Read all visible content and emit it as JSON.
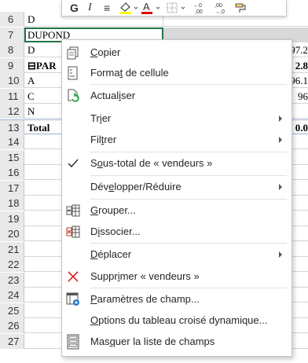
{
  "sheet": {
    "rows": [
      {
        "num": "6",
        "a": "D",
        "b": "",
        "bold": false
      },
      {
        "num": "7",
        "a": "DUPOND",
        "b": "",
        "bold": false,
        "selected": true
      },
      {
        "num": "8",
        "a": "D",
        "b": "97.2",
        "bold": false
      },
      {
        "num": "9",
        "a": "⊟PAR",
        "b": "2.8",
        "bold": true
      },
      {
        "num": "10",
        "a": "A",
        "b": "96.1",
        "bold": false
      },
      {
        "num": "11",
        "a": "C",
        "b": "96",
        "bold": false
      },
      {
        "num": "12",
        "a": "N",
        "b": "",
        "bold": false
      },
      {
        "num": "13",
        "a": "Total",
        "b": "0.0",
        "bold": true,
        "total": true
      },
      {
        "num": "14",
        "a": "",
        "b": ""
      },
      {
        "num": "15",
        "a": "",
        "b": ""
      },
      {
        "num": "16",
        "a": "",
        "b": ""
      },
      {
        "num": "17",
        "a": "",
        "b": ""
      },
      {
        "num": "18",
        "a": "",
        "b": ""
      },
      {
        "num": "19",
        "a": "",
        "b": ""
      },
      {
        "num": "20",
        "a": "",
        "b": ""
      },
      {
        "num": "21",
        "a": "",
        "b": ""
      },
      {
        "num": "22",
        "a": "",
        "b": ""
      },
      {
        "num": "23",
        "a": "",
        "b": ""
      },
      {
        "num": "24",
        "a": "",
        "b": ""
      },
      {
        "num": "25",
        "a": "",
        "b": ""
      },
      {
        "num": "26",
        "a": "",
        "b": ""
      },
      {
        "num": "27",
        "a": "",
        "b": ""
      }
    ]
  },
  "minibar": {
    "bold": "G",
    "italic": "I",
    "align": "≡",
    "fill": "◇",
    "font_color": "A",
    "borders": "⊞",
    "dec_inc": ",00",
    "dec_dec": ",0",
    "paint": "✒"
  },
  "menu": {
    "items": [
      {
        "label": "Copier",
        "icon": "copy-icon",
        "submenu": false
      },
      {
        "label": "Format de cellule",
        "icon": "format-cell-icon",
        "submenu": false
      },
      {
        "label": "Actualiser",
        "icon": "refresh-icon",
        "submenu": false
      },
      {
        "label": "Trier",
        "icon": "",
        "submenu": true
      },
      {
        "label": "Filtrer",
        "icon": "",
        "submenu": true
      },
      {
        "label": "Sous-total de « vendeurs »",
        "icon": "checkmark-icon",
        "submenu": false
      },
      {
        "label": "Développer/Réduire",
        "icon": "",
        "submenu": true
      },
      {
        "label": "Grouper...",
        "icon": "group-icon",
        "submenu": false
      },
      {
        "label": "Dissocier...",
        "icon": "ungroup-icon",
        "submenu": false
      },
      {
        "label": "Déplacer",
        "icon": "",
        "submenu": true
      },
      {
        "label": "Supprimer « vendeurs »",
        "icon": "delete-x-icon",
        "submenu": false
      },
      {
        "label": "Paramètres de champ...",
        "icon": "field-settings-icon",
        "submenu": false
      },
      {
        "label": "Options du tableau croisé dynamique...",
        "icon": "",
        "submenu": false
      },
      {
        "label": "Masquer la liste de champs",
        "icon": "field-list-icon",
        "submenu": false
      }
    ]
  }
}
